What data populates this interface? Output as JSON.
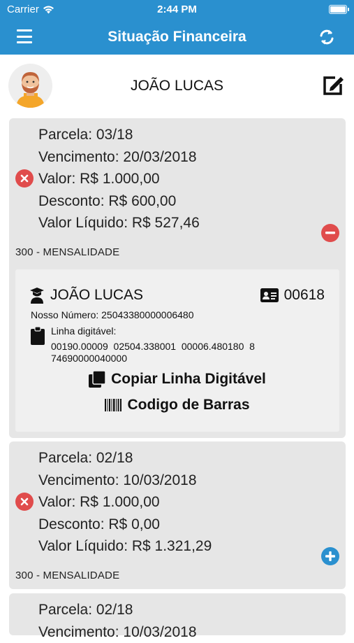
{
  "status_bar": {
    "carrier": "Carrier",
    "time": "2:44 PM"
  },
  "nav": {
    "title": "Situação Financeira",
    "menu_icon": "hamburger-menu-icon",
    "refresh_icon": "refresh-icon"
  },
  "profile": {
    "name": "JOÃO LUCAS",
    "edit_icon": "edit-icon"
  },
  "installments": [
    {
      "parcela": "Parcela: 03/18",
      "vencimento": "Vencimento: 20/03/2018",
      "valor": "Valor: R$ 1.000,00",
      "desconto": "Desconto: R$ 600,00",
      "liquido": "Valor Líquido: R$ 527,46",
      "tipo": "300 - MENSALIDADE",
      "expanded": true,
      "boleto": {
        "nome": "JOÃO LUCAS",
        "codigo": "00618",
        "nosso_numero": "Nosso Número: 25043380000006480",
        "linha_label": "Linha digitável:",
        "linha_value": "00190.00009  02504.338001  00006.480180  8\n74690000040000",
        "copy_label": "Copiar Linha Digitável",
        "barcode_label": "Codigo de Barras"
      }
    },
    {
      "parcela": "Parcela: 02/18",
      "vencimento": "Vencimento: 10/03/2018",
      "valor": "Valor: R$ 1.000,00",
      "desconto": "Desconto: R$ 0,00",
      "liquido": "Valor Líquido: R$ 1.321,29",
      "tipo": "300 - MENSALIDADE",
      "expanded": false
    },
    {
      "parcela": "Parcela: 02/18",
      "vencimento": "Vencimento: 10/03/2018"
    }
  ],
  "colors": {
    "primary": "#2a90cf",
    "danger": "#e04c4c",
    "card": "#e6e6e6",
    "boleto": "#f0f0f0"
  }
}
